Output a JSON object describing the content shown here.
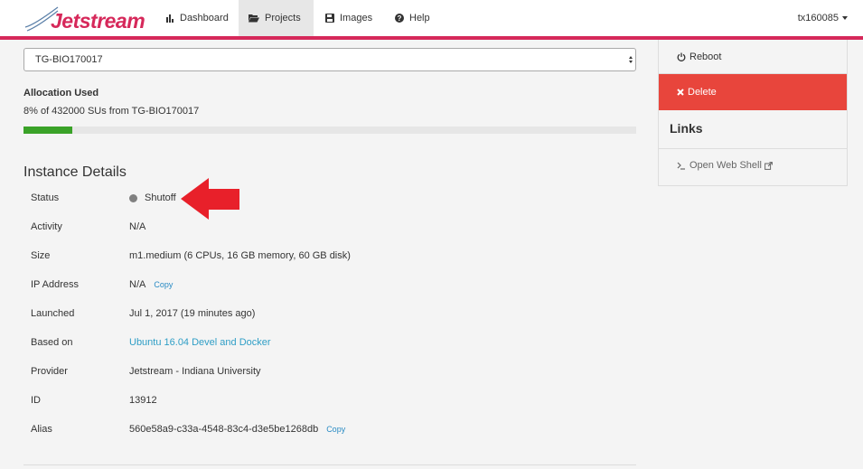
{
  "nav": {
    "logo_text": "Jetstream",
    "items": [
      {
        "label": "Dashboard",
        "icon": "bar-chart-icon",
        "active": false
      },
      {
        "label": "Projects",
        "icon": "folder-open-icon",
        "active": true
      },
      {
        "label": "Images",
        "icon": "save-icon",
        "active": false
      },
      {
        "label": "Help",
        "icon": "question-circle-icon",
        "active": false
      }
    ],
    "user": "tx160085"
  },
  "allocation": {
    "selected": "TG-BIO170017",
    "title": "Allocation Used",
    "summary": "8% of 432000 SUs from TG-BIO170017",
    "percent_used": 8
  },
  "instance_details": {
    "title": "Instance Details",
    "rows": [
      {
        "label": "Status",
        "value": "Shutoff"
      },
      {
        "label": "Activity",
        "value": "N/A"
      },
      {
        "label": "Size",
        "value": "m1.medium (6 CPUs, 16 GB memory, 60 GB disk)"
      },
      {
        "label": "IP Address",
        "value": "N/A",
        "copy": "Copy"
      },
      {
        "label": "Launched",
        "value": "Jul 1, 2017 (19 minutes ago)"
      },
      {
        "label": "Based on",
        "value": "Ubuntu 16.04 Devel and Docker"
      },
      {
        "label": "Provider",
        "value": "Jetstream - Indiana University"
      },
      {
        "label": "ID",
        "value": "13912"
      },
      {
        "label": "Alias",
        "value": "560e58a9-c33a-4548-83c4-d3e5be1268db",
        "copy": "Copy"
      }
    ]
  },
  "sidebar": {
    "reboot_label": "Reboot",
    "delete_label": "Delete",
    "links_title": "Links",
    "web_shell_label": "Open Web Shell"
  },
  "colors": {
    "brand": "#d6285a",
    "delete": "#e8453c",
    "progress": "#3aa228",
    "link": "#2f9ec6",
    "annotation_arrow": "#e8202a"
  }
}
